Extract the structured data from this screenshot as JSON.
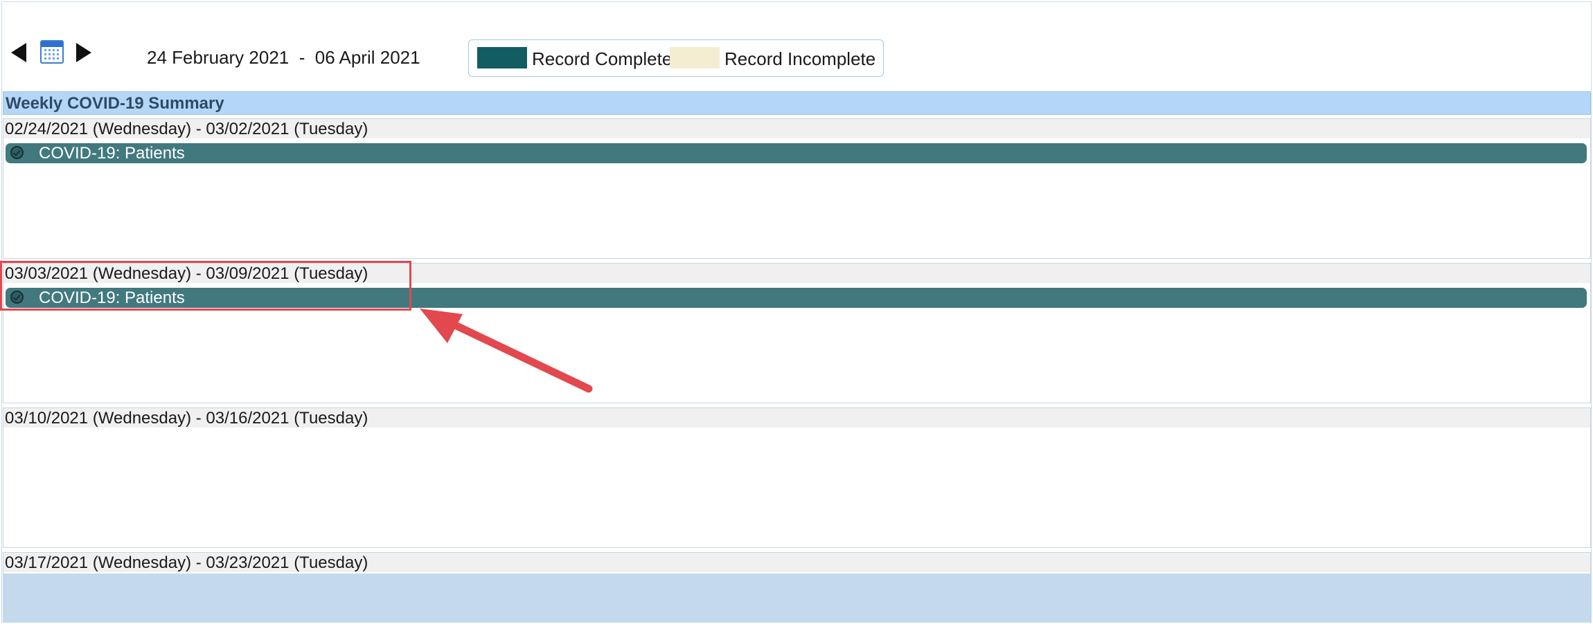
{
  "toolbar": {
    "prev_icon": "left-triangle-icon",
    "calendar_icon": "calendar-icon",
    "next_icon": "right-triangle-icon",
    "date_range": "24 February 2021  -  06 April 2021"
  },
  "legend": {
    "complete_label": "Record Complete",
    "incomplete_label": "Record Incomplete",
    "complete_color": "#115d63",
    "incomplete_color": "#f3eed2"
  },
  "summary": {
    "title": "Weekly COVID-19 Summary"
  },
  "weeks": [
    {
      "title": "02/24/2021 (Wednesday) - 03/02/2021 (Tuesday)",
      "entries": [
        "COVID-19: Patients"
      ]
    },
    {
      "title": "03/03/2021 (Wednesday) - 03/09/2021 (Tuesday)",
      "entries": [
        "COVID-19: Patients"
      ]
    },
    {
      "title": "03/10/2021 (Wednesday) - 03/16/2021 (Tuesday)",
      "entries": []
    },
    {
      "title": "03/17/2021 (Wednesday) - 03/23/2021 (Tuesday)",
      "entries": []
    }
  ],
  "colors": {
    "entry_bar": "#41797f",
    "header_bg": "#b4d7f7",
    "annotation": "#e2484d"
  }
}
